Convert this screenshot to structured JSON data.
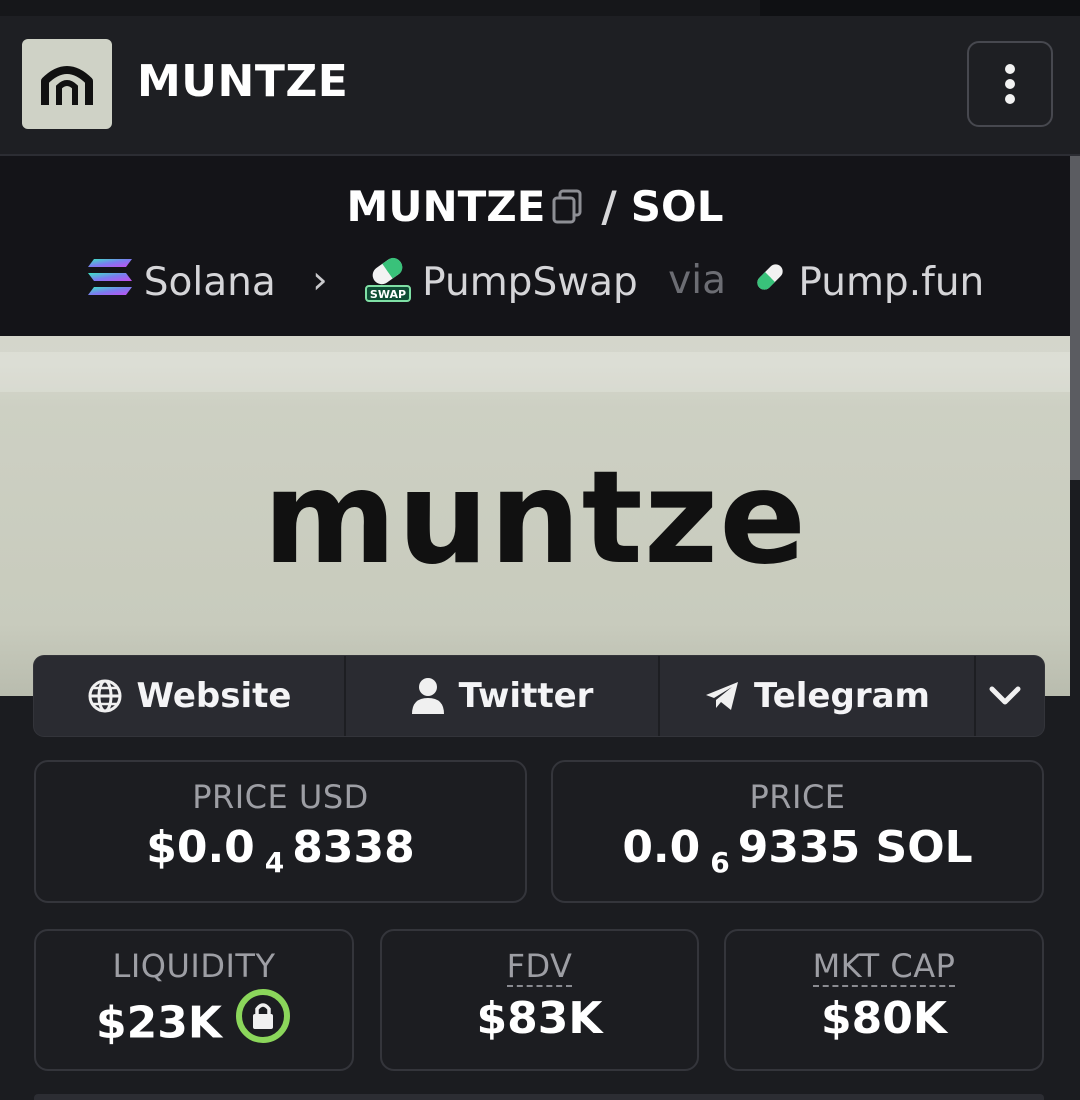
{
  "header": {
    "brand": "MUNTZE",
    "menu_icon": "more-vertical-icon"
  },
  "pair": {
    "base": "MUNTZE",
    "separator": "/",
    "quote": "SOL",
    "chain": "Solana",
    "dex": "PumpSwap",
    "dex_badge": "SWAP",
    "via": "via",
    "launchpad": "Pump.fun"
  },
  "banner": {
    "text": "muntze"
  },
  "links": {
    "website": "Website",
    "twitter": "Twitter",
    "telegram": "Telegram"
  },
  "stats": {
    "price_usd_label": "PRICE USD",
    "price_usd_prefix": "$0.0",
    "price_usd_zeros": "4",
    "price_usd_digits": "8338",
    "price_label": "PRICE",
    "price_prefix": "0.0",
    "price_zeros": "6",
    "price_digits": "9335 SOL",
    "liquidity_label": "LIQUIDITY",
    "liquidity_value": "$23K",
    "fdv_label": "FDV",
    "fdv_value": "$83K",
    "mktcap_label": "MKT CAP",
    "mktcap_value": "$80K"
  },
  "colors": {
    "background": "#1b1c20",
    "lock_ring": "#8bd65b",
    "banner_bg": "#cfd2c5"
  }
}
